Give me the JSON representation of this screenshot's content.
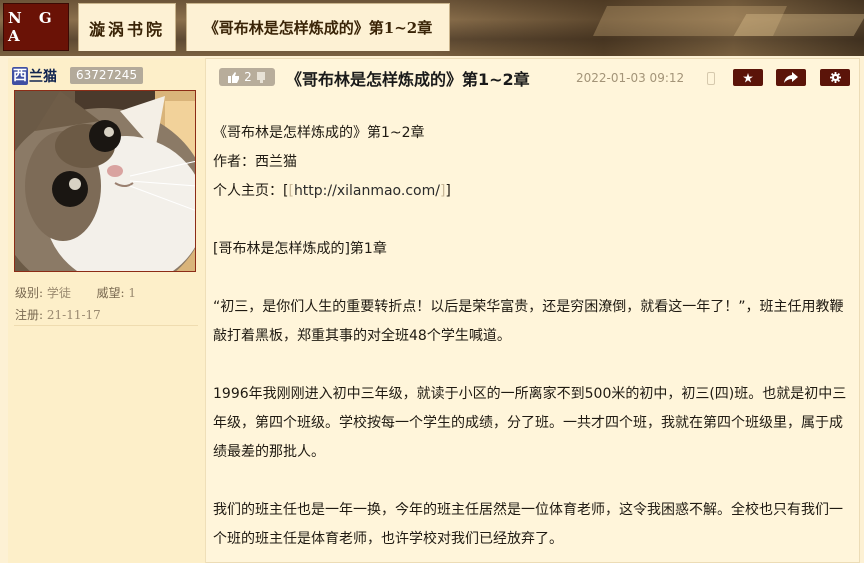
{
  "nav": {
    "logo": "N G A",
    "forum_tab": "漩涡书院",
    "thread_tab": "《哥布林是怎样炼成的》第1~2章"
  },
  "author": {
    "name_first_char": "西",
    "name_rest": "兰猫",
    "uid": "63727245",
    "level_label": "级别:",
    "level_value": "学徒",
    "prestige_label": "威望:",
    "prestige_value": "1",
    "registered_label": "注册:",
    "registered_value": "21-11-17"
  },
  "post": {
    "likes": "2",
    "title": "《哥布林是怎样炼成的》第1~2章",
    "time": "2022-01-03 09:12",
    "icons": [
      "thumbs-up-icon",
      "thumbs-down-icon",
      "mobile-icon",
      "star-icon",
      "share-icon",
      "gear-icon"
    ]
  },
  "content": {
    "line1": "《哥布林是怎样炼成的》第1~2章",
    "line2": "作者：西兰猫",
    "homepage_prefix": "个人主页：[",
    "homepage_url": "http://xilanmao.com/",
    "homepage_suffix": "]",
    "chapter_heading": "[哥布林是怎样炼成的]第1章",
    "para1": "“初三，是你们人生的重要转折点！以后是荣华富贵，还是穷困潦倒，就看这一年了！”，班主任用教鞭敲打着黑板，郑重其事的对全班48个学生喊道。",
    "para2": "1996年我刚刚进入初中三年级，就读于小区的一所离家不到500米的初中，初三(四)班。也就是初中三年级，第四个班级。学校按每一个学生的成绩，分了班。一共才四个班，我就在第四个班级里，属于成绩最差的那批人。",
    "para3": "我们的班主任也是一年一换，今年的班主任居然是一位体育老师，这令我困惑不解。全校也只有我们一个班的班主任是体育老师，也许学校对我们已经放弃了。"
  }
}
